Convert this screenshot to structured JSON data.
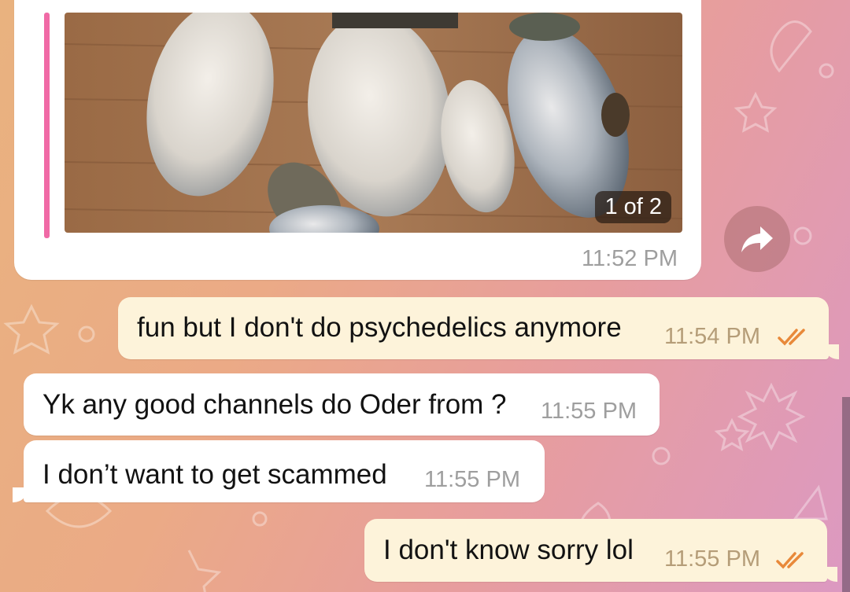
{
  "chat": {
    "photo_message": {
      "counter": "1 of 2",
      "time": "11:52 PM",
      "share_icon": "share-arrow-icon"
    },
    "messages": [
      {
        "direction": "outgoing",
        "text": "fun but I don't do psychedelics anymore",
        "time": "11:54 PM",
        "status": "read-double-check"
      },
      {
        "direction": "incoming",
        "text": "Yk any good channels do Oder from ?",
        "time": "11:55 PM"
      },
      {
        "direction": "incoming",
        "text": "I don’t want to get scammed",
        "time": "11:55 PM"
      },
      {
        "direction": "outgoing",
        "text": "I don't know sorry lol",
        "time": "11:55 PM",
        "status": "read-double-check"
      }
    ]
  },
  "colors": {
    "incoming_bubble": "#ffffff",
    "outgoing_bubble": "#fdf3da",
    "reply_accent": "#f06aa6",
    "check_color": "#e8893a"
  }
}
